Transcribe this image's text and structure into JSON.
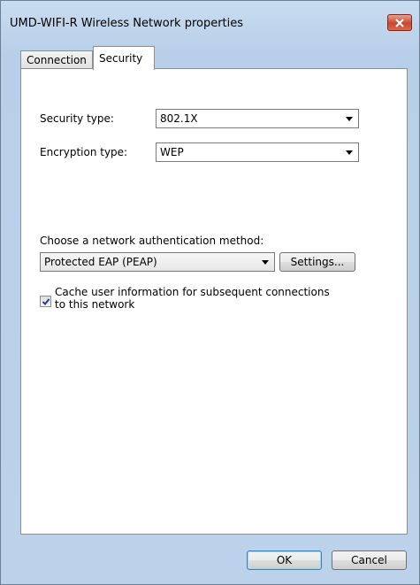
{
  "window": {
    "title": "UMD-WIFI-R Wireless Network properties"
  },
  "tabs": [
    {
      "label": "Connection",
      "active": false
    },
    {
      "label": "Security",
      "active": true
    }
  ],
  "security": {
    "security_type_label": "Security type:",
    "security_type_value": "802.1X",
    "encryption_type_label": "Encryption type:",
    "encryption_type_value": "WEP",
    "auth_method_label": "Choose a network authentication method:",
    "auth_method_value": "Protected EAP (PEAP)",
    "settings_button": "Settings...",
    "cache_checkbox_line1": "Cache user information for subsequent connections",
    "cache_checkbox_line2": "to this network",
    "cache_checked": true
  },
  "footer": {
    "ok_label": "OK",
    "cancel_label": "Cancel"
  },
  "icons": {
    "close": "close-icon",
    "dropdown": "chevron-down-icon",
    "check": "checkmark-icon"
  },
  "colors": {
    "close_button": "#c8472e",
    "check_mark": "#1f3f9e",
    "default_button_border": "#3c7fb1"
  }
}
